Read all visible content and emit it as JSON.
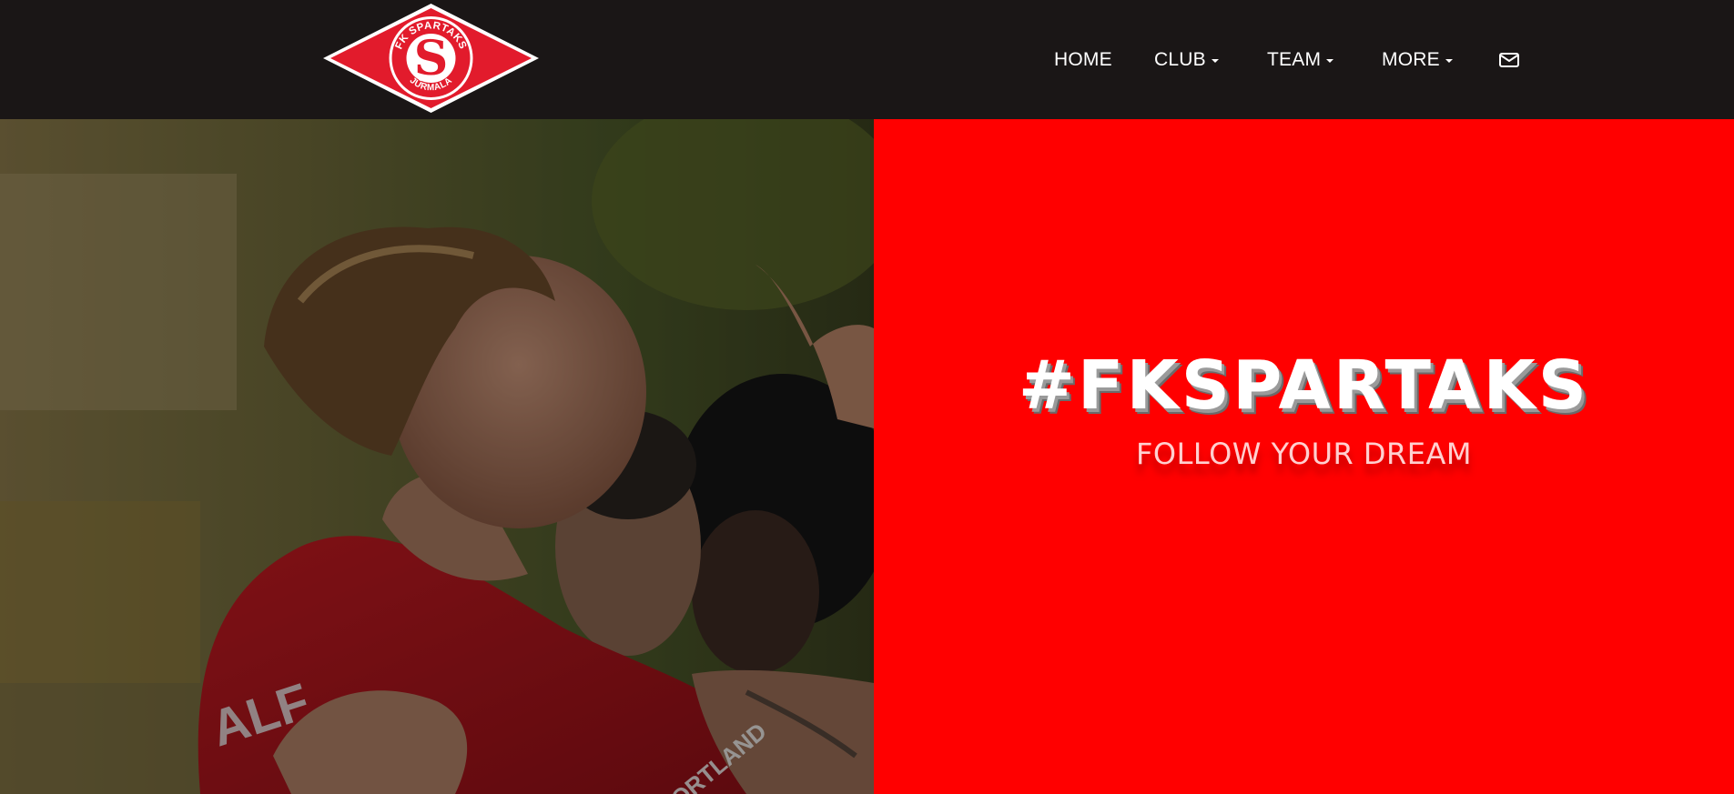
{
  "header": {
    "logo": {
      "text_top": "FK SPARTAKS",
      "text_bottom": "JŪRMALA",
      "letter": "S"
    },
    "nav": {
      "home": "HOME",
      "club": "CLUB",
      "team": "TEAM",
      "more": "MORE"
    },
    "mail_icon": "envelope-icon"
  },
  "hero": {
    "title": "#FKSPARTAKS",
    "subtitle": "FOLLOW YOUR DREAM",
    "photo": {
      "jersey_name": "ALF",
      "sponsor": "SPORTLAND"
    }
  },
  "colors": {
    "header_bg": "#1a1616",
    "brand_red": "#ff0000",
    "logo_red": "#e21b2c"
  }
}
